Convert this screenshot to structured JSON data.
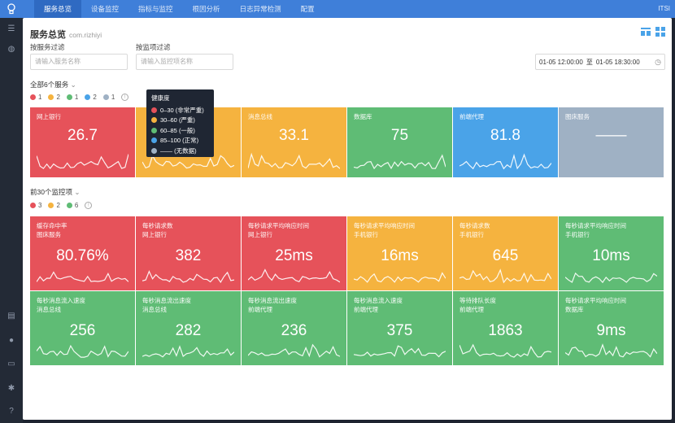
{
  "colors": {
    "red": "#e6525a",
    "orange": "#f5b33f",
    "green": "#5fbc75",
    "blue": "#4aa3e8",
    "gray": "#9fb1c4"
  },
  "topbar": {
    "logo_icon": "bulb-icon",
    "nav": [
      "服务总览",
      "设备监控",
      "指标与监控",
      "根因分析",
      "日志异常检测",
      "配置"
    ],
    "brand": "ITSI"
  },
  "sidebar": {
    "icons": [
      "list-icon",
      "globe-icon",
      "chat-icon",
      "user-icon",
      "monitor-icon",
      "gear-icon",
      "help-icon"
    ]
  },
  "page": {
    "title": "服务总览",
    "subtitle": "com.rizhiyi"
  },
  "filters": {
    "service_label": "按服务过滤",
    "service_placeholder": "请输入服务名称",
    "monitor_label": "按监项过滤",
    "monitor_placeholder": "请输入监控项名称",
    "date_from": "01-05 12:00:00",
    "date_sep": "至",
    "date_to": "01-05 18:30:00"
  },
  "services": {
    "title": "全部6个服务",
    "legend": [
      {
        "color": "red",
        "count": "1"
      },
      {
        "color": "orange",
        "count": "2"
      },
      {
        "color": "green",
        "count": "1"
      },
      {
        "color": "blue",
        "count": "2"
      },
      {
        "color": "gray",
        "count": "1"
      }
    ],
    "tiles": [
      {
        "name": "网上银行",
        "value": "26.7",
        "color": "red"
      },
      {
        "name": "",
        "value": "",
        "color": "orange"
      },
      {
        "name": "消息总线",
        "value": "33.1",
        "color": "orange"
      },
      {
        "name": "数据库",
        "value": "75",
        "color": "green"
      },
      {
        "name": "前端代理",
        "value": "81.8",
        "color": "blue"
      },
      {
        "name": "图床服务",
        "value": "——",
        "color": "gray"
      }
    ]
  },
  "tooltip": {
    "title": "健康度",
    "rows": [
      {
        "color": "red",
        "label": "0–30 (非常严重)"
      },
      {
        "color": "orange",
        "label": "30–60 (严重)"
      },
      {
        "color": "green",
        "label": "60–85 (一般)"
      },
      {
        "color": "blue",
        "label": "85–100 (正常)"
      },
      {
        "color": "gray",
        "label": "—— (无数据)"
      }
    ]
  },
  "monitors": {
    "title": "前30个监控项",
    "legend": [
      {
        "color": "red",
        "count": "3"
      },
      {
        "color": "orange",
        "count": "2"
      },
      {
        "color": "green",
        "count": "6"
      }
    ],
    "tiles": [
      {
        "name": "缓存命中率\n图床服务",
        "value": "80.76%",
        "color": "red"
      },
      {
        "name": "每秒请求数\n网上银行",
        "value": "382",
        "color": "red"
      },
      {
        "name": "每秒请求平均响应时间\n网上银行",
        "value": "25ms",
        "color": "red"
      },
      {
        "name": "每秒请求平均响应时间\n手机银行",
        "value": "16ms",
        "color": "orange"
      },
      {
        "name": "每秒请求数\n手机银行",
        "value": "645",
        "color": "orange"
      },
      {
        "name": "每秒请求平均响应时间\n手机银行",
        "value": "10ms",
        "color": "green"
      },
      {
        "name": "每秒消息流入速度\n消息总线",
        "value": "256",
        "color": "green"
      },
      {
        "name": "每秒消息流出速度\n消息总线",
        "value": "282",
        "color": "green"
      },
      {
        "name": "每秒消息流出速度\n前端代理",
        "value": "236",
        "color": "green"
      },
      {
        "name": "每秒消息流入速度\n前端代理",
        "value": "375",
        "color": "green"
      },
      {
        "name": "等待排队长度\n前端代理",
        "value": "1863",
        "color": "green"
      },
      {
        "name": "每秒请求平均响应时间\n数据库",
        "value": "9ms",
        "color": "green"
      }
    ]
  }
}
